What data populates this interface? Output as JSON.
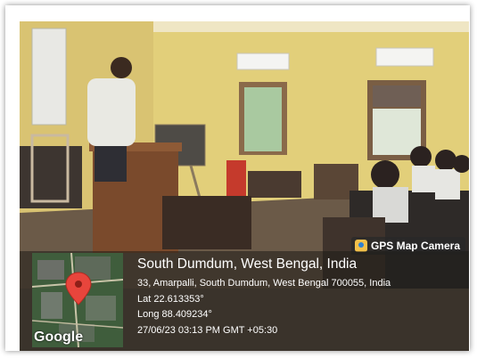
{
  "stamp": {
    "brand": "GPS Map Camera",
    "place": "South Dumdum, West Bengal, India",
    "address": "33, Amarpalli, South Dumdum, West Bengal 700055, India",
    "lat": "Lat 22.613353°",
    "long": "Long 88.409234°",
    "datetime": "27/06/23 03:13 PM GMT +05:30",
    "map_attribution": "Google"
  },
  "colors": {
    "wall": "#e9d47f",
    "pin": "#e8453c"
  }
}
